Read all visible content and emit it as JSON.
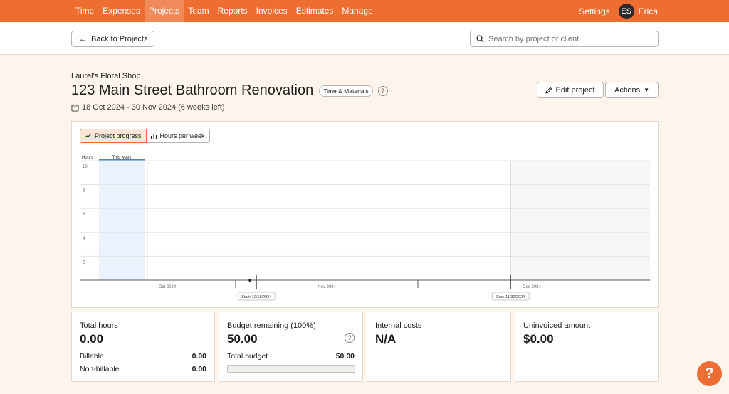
{
  "nav": {
    "items": [
      "Time",
      "Expenses",
      "Projects",
      "Team",
      "Reports",
      "Invoices",
      "Estimates",
      "Manage"
    ],
    "active": "Projects",
    "settings_label": "Settings",
    "user_initials": "ES",
    "user_name": "Erica"
  },
  "subbar": {
    "back_label": "Back to Projects",
    "search_placeholder": "Search by project or client"
  },
  "project": {
    "client": "Laurel's Floral Shop",
    "title": "123 Main Street Bathroom Renovation",
    "type_badge": "Time & Materials",
    "help": "?",
    "dates": "18 Oct 2024 - 30 Nov 2024 (6 weeks left)",
    "edit_label": "Edit project",
    "actions_label": "Actions"
  },
  "chart": {
    "toggle_progress": "Project progress",
    "toggle_hours": "Hours per week",
    "hours_label": "Hours",
    "this_week_label": "This week",
    "start_label": "Start: 10/18/2024",
    "end_label": "End: 11/30/2024",
    "colors": {
      "accent": "#ee6d31",
      "this_week": "#eaf3fd",
      "this_week_line": "#4a86c5",
      "post_end": "#f7f7f7"
    }
  },
  "chart_data": {
    "type": "line",
    "ylabel": "Hours",
    "yticks": [
      2,
      4,
      6,
      8,
      10
    ],
    "ylim": [
      0,
      10
    ],
    "xticks": [
      "Oct 2024",
      "Nov 2024",
      "Dec 2024"
    ],
    "series": [
      {
        "points": [
          {
            "x": "2024-10-18",
            "y": 0
          }
        ]
      }
    ],
    "start_date": "2024-10-18",
    "end_date": "2024-11-30"
  },
  "stats": {
    "total_hours": {
      "label": "Total hours",
      "value": "0.00",
      "billable_label": "Billable",
      "billable_value": "0.00",
      "nonbillable_label": "Non-billable",
      "nonbillable_value": "0.00"
    },
    "budget": {
      "label": "Budget remaining (100%)",
      "value": "50.00",
      "total_label": "Total budget",
      "total_value": "50.00",
      "used_fraction": 0
    },
    "internal": {
      "label": "Internal costs",
      "value": "N/A"
    },
    "uninvoiced": {
      "label": "Uninvoiced amount",
      "value": "$0.00"
    }
  },
  "help_fab": "?"
}
